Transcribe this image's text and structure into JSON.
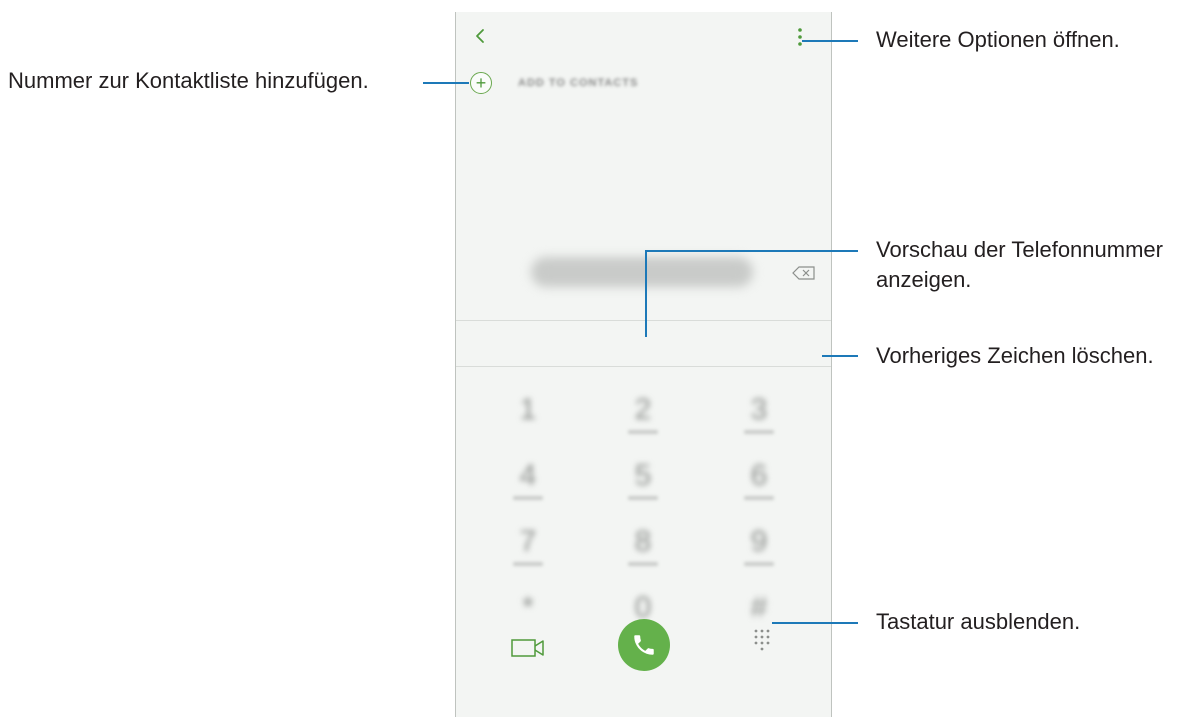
{
  "phone": {
    "add_to_contacts_label": "ADD TO CONTACTS",
    "keypad": {
      "digits": [
        "1",
        "2",
        "3",
        "4",
        "5",
        "6",
        "7",
        "8",
        "9",
        "*",
        "0",
        "#"
      ]
    },
    "accent_color": "#64b14b",
    "icons": {
      "back": "chevron-left-icon",
      "more": "more-options-icon",
      "add": "plus-circle-icon",
      "backspace": "backspace-icon",
      "video": "video-call-icon",
      "call": "phone-icon",
      "keypad": "keypad-icon"
    }
  },
  "annotations": {
    "more_options": "Weitere Optionen öffnen.",
    "add_to_contacts": "Nummer zur Kontaktliste hinzufügen.",
    "preview_line1": "Vorschau der Telefonnummer",
    "preview_line2": "anzeigen.",
    "delete_char": "Vorheriges Zeichen löschen.",
    "hide_keypad": "Tastatur ausblenden."
  },
  "callout_color": "#1d79b8"
}
